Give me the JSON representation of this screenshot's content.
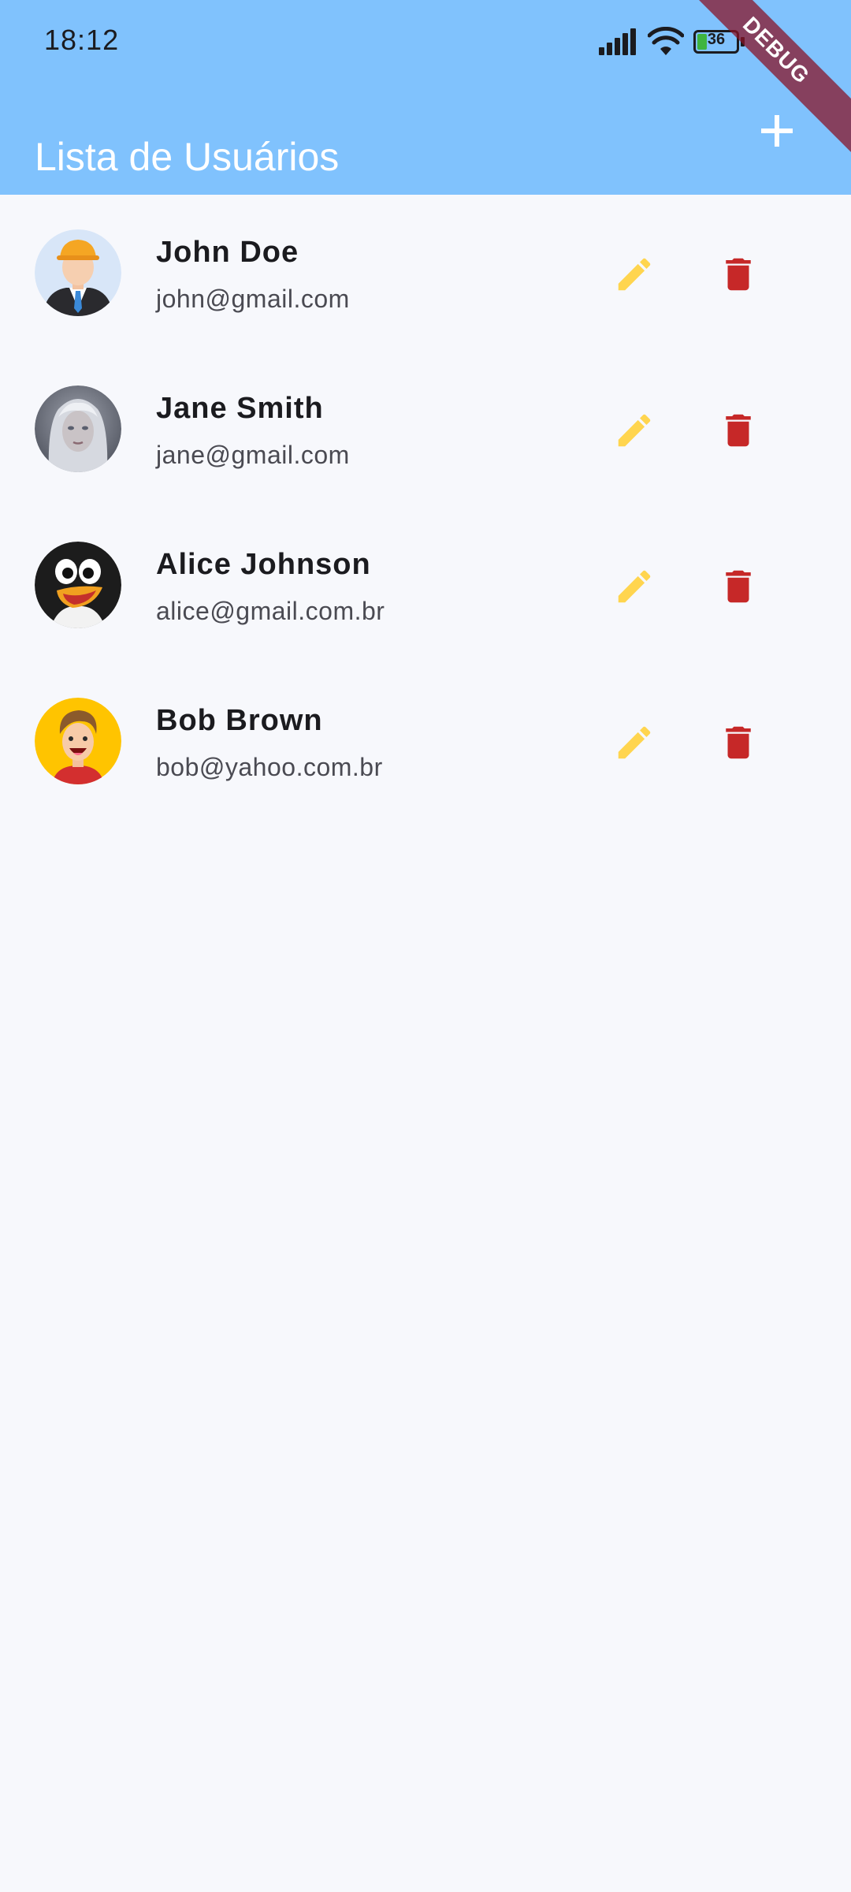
{
  "status_bar": {
    "time": "18:12",
    "battery_level": "36"
  },
  "debug_banner": "DEBUG",
  "app_bar": {
    "title": "Lista de Usuários",
    "add_icon": "plus-icon"
  },
  "colors": {
    "app_bar": "#80c2fd",
    "background": "#f7f8fc",
    "edit_icon": "#ffd54f",
    "delete_icon": "#c62828"
  },
  "users": [
    {
      "name": "John Doe",
      "email": "john@gmail.com",
      "avatar": "construction-worker-avatar"
    },
    {
      "name": "Jane Smith",
      "email": "jane@gmail.com",
      "avatar": "silver-hair-woman-avatar"
    },
    {
      "name": "Alice Johnson",
      "email": "alice@gmail.com.br",
      "avatar": "penguin-avatar"
    },
    {
      "name": "Bob Brown",
      "email": "bob@yahoo.com.br",
      "avatar": "cartoon-boy-avatar"
    }
  ]
}
